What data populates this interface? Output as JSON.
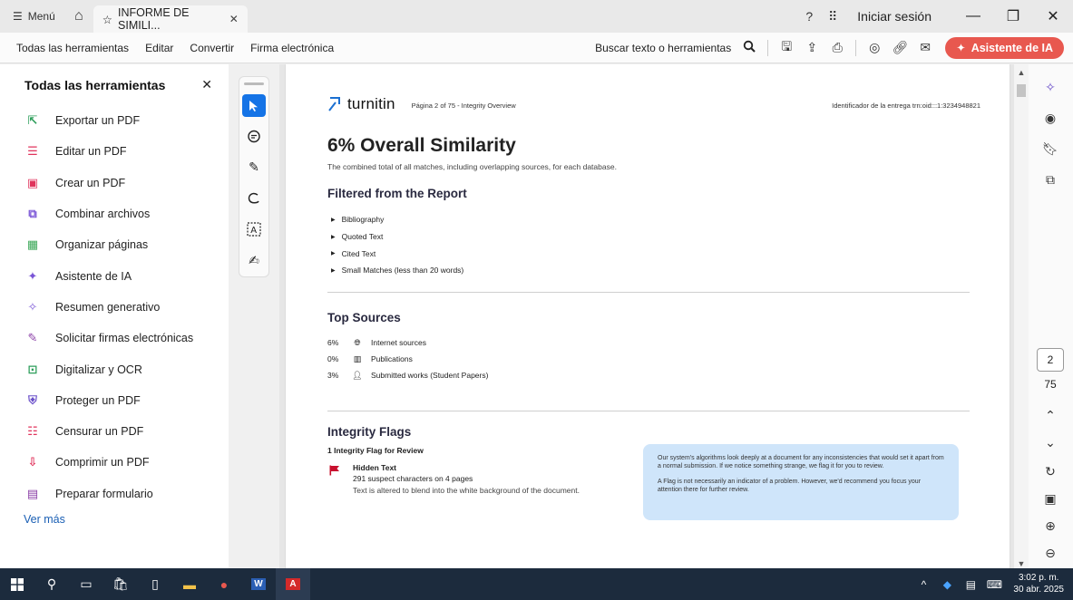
{
  "titlebar": {
    "menu_label": "Menú",
    "tab_title": "INFORME DE SIMILI...",
    "signin_label": "Iniciar sesión"
  },
  "toolbar": {
    "items": [
      "Todas las herramientas",
      "Editar",
      "Convertir",
      "Firma electrónica"
    ],
    "search_label": "Buscar texto o herramientas",
    "ai_button": "Asistente de IA"
  },
  "left_panel": {
    "title": "Todas las herramientas",
    "items": [
      {
        "label": "Exportar un PDF",
        "icon": "export-pdf-icon",
        "color": "#2e9e5b"
      },
      {
        "label": "Editar un PDF",
        "icon": "edit-pdf-icon",
        "color": "#e0345c"
      },
      {
        "label": "Crear un PDF",
        "icon": "create-pdf-icon",
        "color": "#e0345c"
      },
      {
        "label": "Combinar archivos",
        "icon": "combine-files-icon",
        "color": "#7a55d6"
      },
      {
        "label": "Organizar páginas",
        "icon": "organize-pages-icon",
        "color": "#3aa757"
      },
      {
        "label": "Asistente de IA",
        "icon": "ai-assistant-icon",
        "color": "#7a55d6"
      },
      {
        "label": "Resumen generativo",
        "icon": "generative-summary-icon",
        "color": "#7a55d6"
      },
      {
        "label": "Solicitar firmas electrónicas",
        "icon": "request-signatures-icon",
        "color": "#8a3ea6"
      },
      {
        "label": "Digitalizar y OCR",
        "icon": "scan-ocr-icon",
        "color": "#2e9e5b"
      },
      {
        "label": "Proteger un PDF",
        "icon": "protect-pdf-icon",
        "color": "#6a4fc9"
      },
      {
        "label": "Censurar un PDF",
        "icon": "redact-pdf-icon",
        "color": "#e0345c"
      },
      {
        "label": "Comprimir un PDF",
        "icon": "compress-pdf-icon",
        "color": "#e0345c"
      },
      {
        "label": "Preparar formulario",
        "icon": "prepare-form-icon",
        "color": "#8a3ea6"
      }
    ],
    "more_label": "Ver más"
  },
  "document": {
    "logo_text": "turnitin",
    "page_info": "Página 2 of 75 - Integrity Overview",
    "submission_id": "Identificador de la entrega trn:oid:::1:3234948821",
    "title": "6% Overall Similarity",
    "subtitle": "The combined total of all matches, including overlapping sources, for each database.",
    "filtered_heading": "Filtered from the Report",
    "filtered_items": [
      "Bibliography",
      "Quoted Text",
      "Cited Text",
      "Small Matches (less than 20 words)"
    ],
    "sources_heading": "Top Sources",
    "sources": [
      {
        "pct": "6%",
        "label": "Internet sources",
        "icon": "globe-icon"
      },
      {
        "pct": "0%",
        "label": "Publications",
        "icon": "book-icon"
      },
      {
        "pct": "3%",
        "label": "Submitted works (Student Papers)",
        "icon": "person-icon"
      }
    ],
    "flags_heading": "Integrity Flags",
    "flags_count": "1 Integrity Flag for Review",
    "flag_title": "Hidden Text",
    "flag_line": "291 suspect characters on 4 pages",
    "flag_desc": "Text is altered to blend into the white background of the document.",
    "note_p1": "Our system's algorithms look deeply at a document for any inconsistencies that would set it apart from a normal submission. If we notice something strange, we flag it for you to review.",
    "note_p2": "A Flag is not necessarily an indicator of a problem. However, we'd recommend you focus your attention there for further review."
  },
  "right_rail": {
    "current_page": "2",
    "total_pages": "75"
  },
  "taskbar": {
    "time": "3:02 p. m.",
    "date": "30 abr. 2025"
  },
  "colors": {
    "accent": "#1473e6",
    "ai_button": "#e8584f",
    "note_bg": "#cfe5fa",
    "flag_red": "#c8102e",
    "turnitin_blue": "#1a6fd1"
  }
}
